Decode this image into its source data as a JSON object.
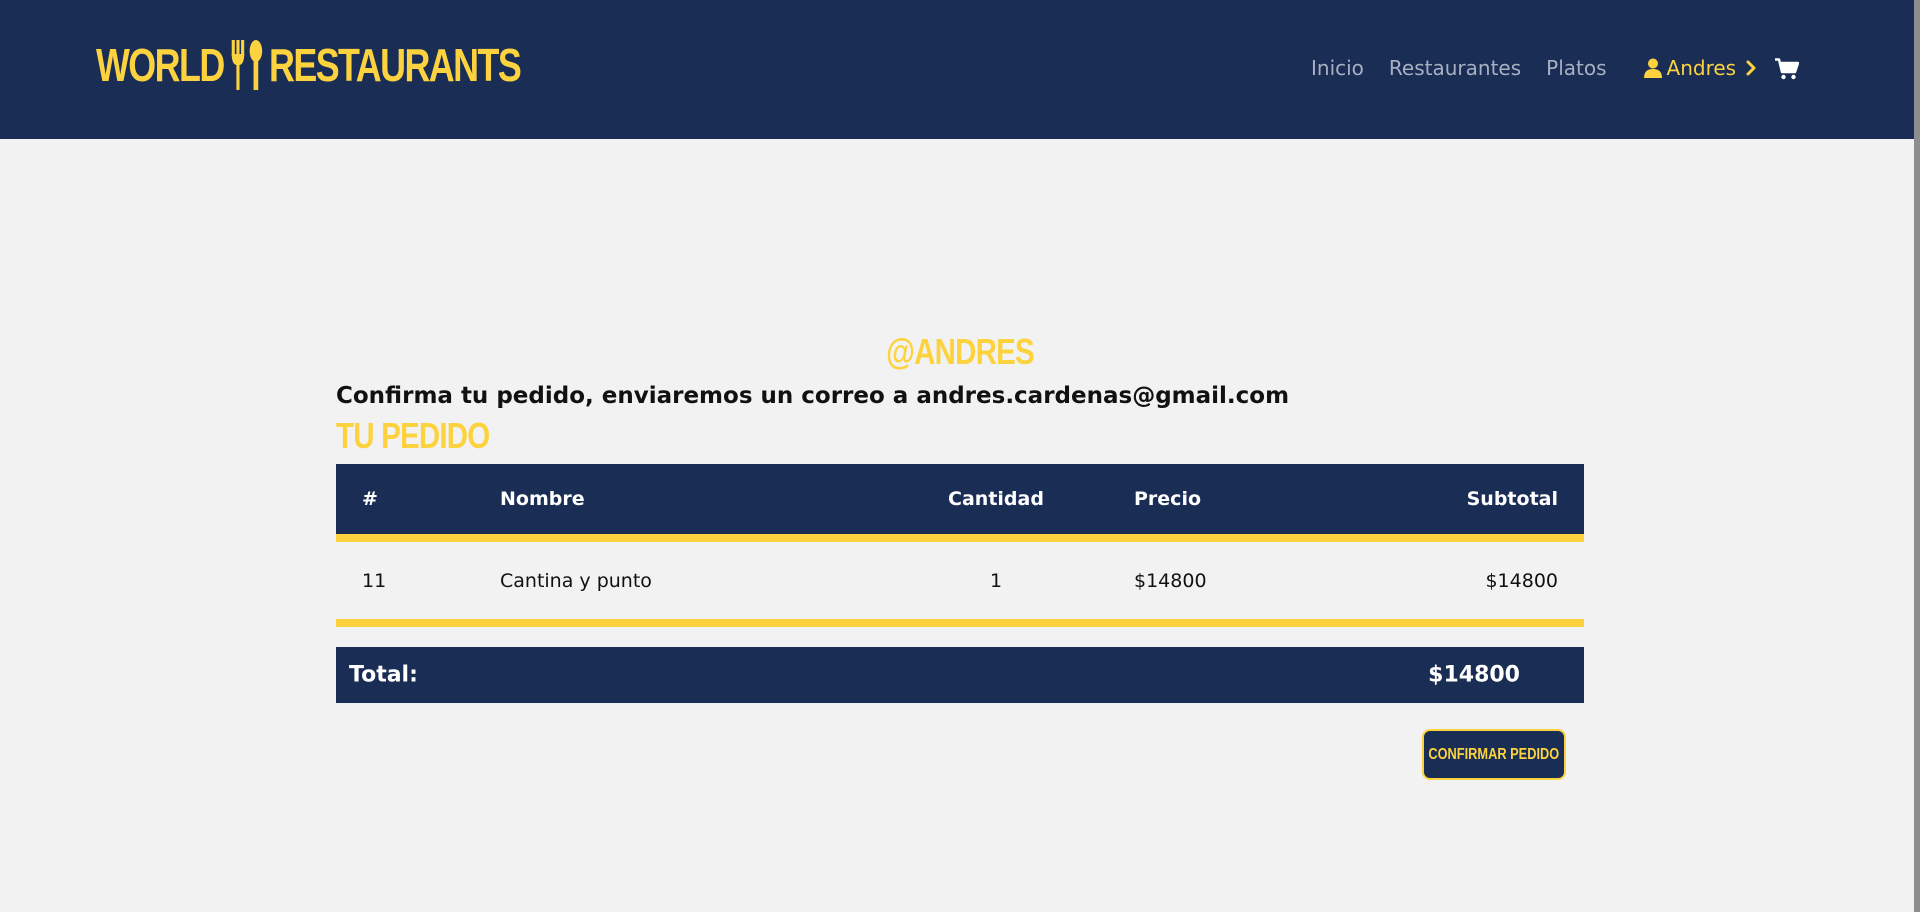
{
  "brand": {
    "name_left": "WORLD",
    "name_right": "RESTAURANTS",
    "color": "#fcd33f"
  },
  "nav": {
    "links": [
      "Inicio",
      "Restaurantes",
      "Platos"
    ],
    "user": "Andres",
    "user_icon": "user-icon",
    "cart_icon": "shopping-cart-icon"
  },
  "page": {
    "username": "@ANDRES",
    "confirm_message": "Confirma tu pedido, enviaremos un correo a andres.cardenas@gmail.com",
    "section_title": "TU PEDIDO"
  },
  "order_table": {
    "headers": {
      "num": "#",
      "name": "Nombre",
      "qty": "Cantidad",
      "price": "Precio",
      "subtotal": "Subtotal"
    },
    "rows": [
      {
        "num": "11",
        "name": "Cantina y punto",
        "qty": "1",
        "price": "$14800",
        "subtotal": "$14800"
      }
    ]
  },
  "total": {
    "label": "Total:",
    "value": "$14800"
  },
  "actions": {
    "confirm_label": "CONFIRMAR PEDIDO"
  },
  "colors": {
    "navy": "#1a2d55",
    "accent": "#fcd33f",
    "background": "#f2f2f2"
  }
}
